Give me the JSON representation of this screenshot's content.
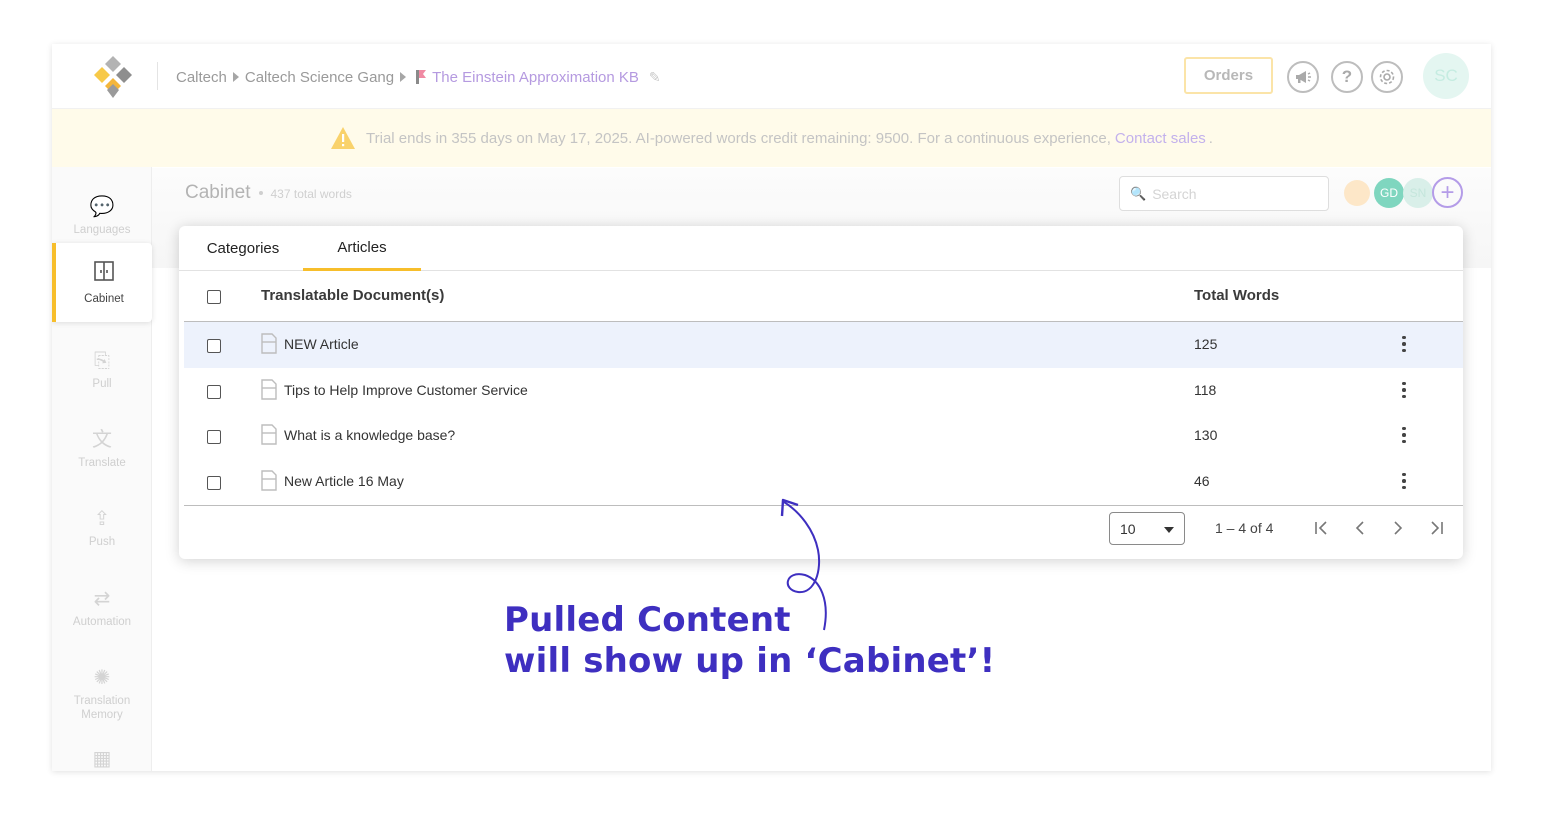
{
  "breadcrumbs": [
    "Caltech",
    "Caltech Science Gang",
    "The Einstein Approximation KB"
  ],
  "header": {
    "orders_label": "Orders",
    "user_initials": "SC"
  },
  "banner": {
    "text": "Trial ends in 355 days on May 17, 2025. AI-powered words credit remaining: 9500. For a continuous experience,",
    "link": "Contact sales",
    "suffix": "."
  },
  "sidebar": {
    "items": [
      {
        "label": "Languages"
      },
      {
        "label": "Cabinet"
      },
      {
        "label": "Pull"
      },
      {
        "label": "Translate"
      },
      {
        "label": "Push"
      },
      {
        "label": "Automation"
      },
      {
        "label": "Translation Memory"
      }
    ]
  },
  "content": {
    "title": "Cabinet",
    "total_words": "437 total words",
    "search_placeholder": "Search",
    "members": [
      {
        "initials": "GD",
        "color": "#7fd6bf"
      },
      {
        "initials": "SN",
        "color": "#d9efe9"
      }
    ]
  },
  "tabs": [
    {
      "label": "Categories"
    },
    {
      "label": "Articles"
    }
  ],
  "table": {
    "headers": {
      "document": "Translatable Document(s)",
      "words": "Total Words"
    },
    "rows": [
      {
        "title": "NEW Article",
        "words": "125"
      },
      {
        "title": "Tips to Help Improve Customer Service",
        "words": "118"
      },
      {
        "title": "What is a knowledge base?",
        "words": "130"
      },
      {
        "title": "New Article 16 May",
        "words": "46"
      }
    ],
    "page_size": "10",
    "range": "1 – 4 of 4"
  },
  "annotation": {
    "line1": "Pulled Content",
    "line2": "will show up in ‘Cabinet’!"
  },
  "colors": {
    "accent": "#f7be2b",
    "brand_purple": "#b49ce8",
    "annotation": "#3e2fc0",
    "highlight_row": "#edf2fc"
  }
}
